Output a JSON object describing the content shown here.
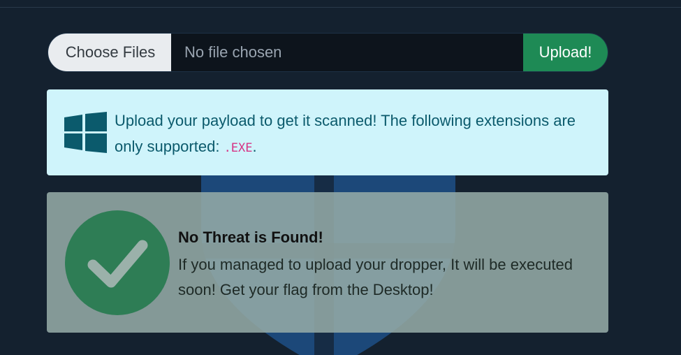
{
  "upload": {
    "choose_label": "Choose Files",
    "file_status": "No file chosen",
    "submit_label": "Upload!"
  },
  "info_alert": {
    "icon": "windows-logo-icon",
    "message": "Upload your payload to get it scanned! The following extensions are only supported:",
    "extension": ".EXE",
    "suffix": "."
  },
  "result_alert": {
    "icon": "check-circle-icon",
    "title": "No Threat is Found!",
    "message": "If you managed to upload your dropper, It will be executed soon! Get your flag from the Desktop!"
  },
  "colors": {
    "background": "#14212f",
    "upload_button": "#1e8a55",
    "info_background": "#cff4fb",
    "info_text": "#0b5a6c",
    "code_text": "#d63384",
    "check_circle": "#2e7d55"
  }
}
